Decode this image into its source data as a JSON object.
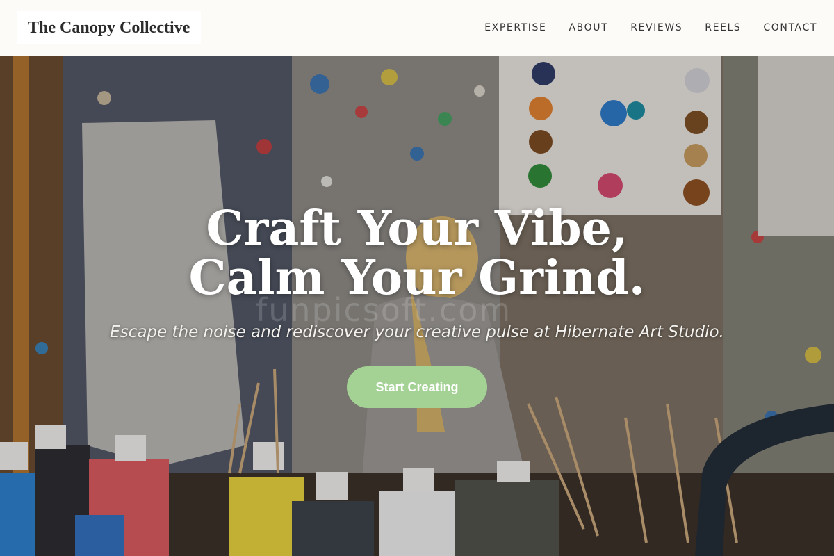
{
  "header": {
    "brand": "The Canopy Collective",
    "nav": [
      {
        "label": "EXPERTISE"
      },
      {
        "label": "ABOUT"
      },
      {
        "label": "REVIEWS"
      },
      {
        "label": "REELS"
      },
      {
        "label": "CONTACT"
      }
    ]
  },
  "hero": {
    "headline_line1": "Craft Your Vibe,",
    "headline_line2": "Calm Your Grind.",
    "subheadline": "Escape the noise and rediscover your creative pulse at Hibernate Art Studio.",
    "cta_label": "Start Creating",
    "watermark": "funpicsoft.com"
  },
  "colors": {
    "header_bg": "#fcfbf7",
    "cta_bg": "#a3d294",
    "headline": "#ffffff"
  }
}
